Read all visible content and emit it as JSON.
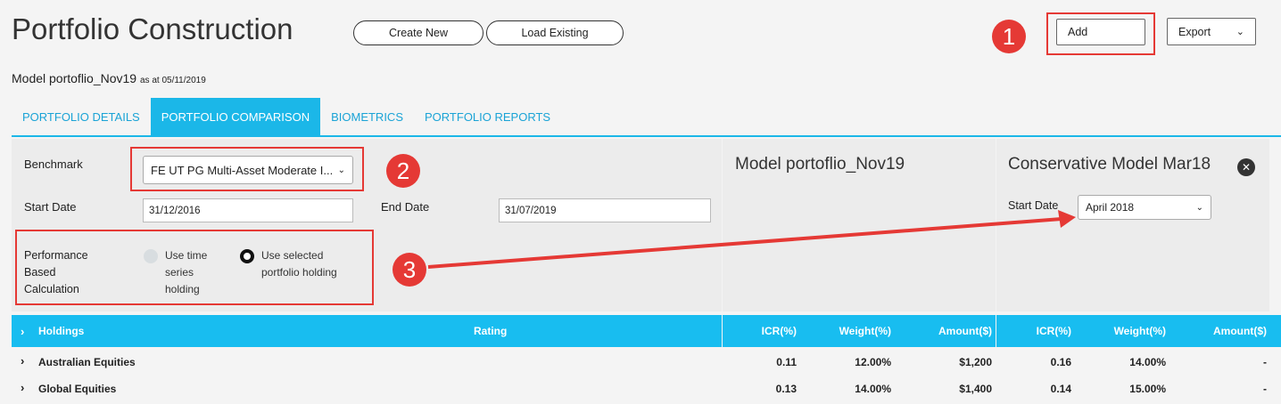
{
  "header": {
    "title": "Portfolio Construction",
    "create_new": "Create New",
    "load_existing": "Load Existing",
    "add": "Add",
    "export": "Export"
  },
  "subtitle": {
    "name": "Model portoflio_Nov19",
    "as_at": "as at 05/11/2019"
  },
  "tabs": [
    {
      "label": "PORTFOLIO DETAILS",
      "active": false
    },
    {
      "label": "PORTFOLIO COMPARISON",
      "active": true
    },
    {
      "label": "BIOMETRICS",
      "active": false
    },
    {
      "label": "PORTFOLIO REPORTS",
      "active": false
    }
  ],
  "settings": {
    "benchmark_label": "Benchmark",
    "benchmark_value": "FE UT PG Multi-Asset Moderate I...",
    "start_date_label": "Start Date",
    "start_date_value": "31/12/2016",
    "end_date_label": "End Date",
    "end_date_value": "31/07/2019",
    "perf_label_1": "Performance",
    "perf_label_2": "Based",
    "perf_label_3": "Calculation",
    "opt1_line1": "Use time",
    "opt1_line2": "series",
    "opt1_line3": "holding",
    "opt2_line1": "Use selected",
    "opt2_line2": "portfolio holding"
  },
  "compare": {
    "model_title": "Model portoflio_Nov19",
    "other_title": "Conservative Model Mar18",
    "other_start_label": "Start Date",
    "other_start_value": "April 2018"
  },
  "annotations": [
    "1",
    "2",
    "3"
  ],
  "table": {
    "headers": {
      "holdings": "Holdings",
      "rating": "Rating",
      "icr": "ICR(%)",
      "weight": "Weight(%)",
      "amount": "Amount($)"
    },
    "rows": [
      {
        "name": "Australian Equities",
        "icr1": "0.11",
        "w1": "12.00%",
        "a1": "$1,200",
        "icr2": "0.16",
        "w2": "14.00%",
        "a2": "-"
      },
      {
        "name": "Global Equities",
        "icr1": "0.13",
        "w1": "14.00%",
        "a1": "$1,400",
        "icr2": "0.14",
        "w2": "15.00%",
        "a2": "-"
      }
    ]
  },
  "colors": {
    "accent": "#1bb7e8",
    "annotation": "#e53935"
  }
}
